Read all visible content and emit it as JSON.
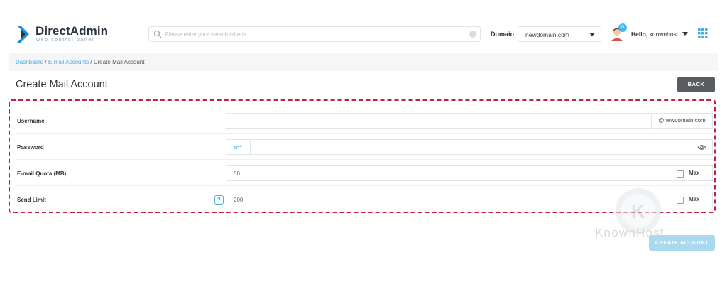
{
  "brand": {
    "name": "DirectAdmin",
    "tagline": "web control panel",
    "accent": "#1d8ed6"
  },
  "header": {
    "search_placeholder": "Please enter your search criteria",
    "domain_label": "Domain",
    "domain_value": "newdomain.com",
    "notification_count": "0",
    "hello_prefix": "Hello,",
    "username": "knownhost"
  },
  "breadcrumb": {
    "items": [
      "Dashboard",
      "E-mail Accounts",
      "Create Mail Account"
    ],
    "separator": " / "
  },
  "page": {
    "title": "Create Mail Account",
    "back_label": "BACK"
  },
  "form": {
    "username": {
      "label": "Username",
      "value": "",
      "suffix": "@newdomain.com"
    },
    "password": {
      "label": "Password",
      "value": ""
    },
    "quota": {
      "label": "E-mail Quota (MB)",
      "value": "50",
      "max_label": "Max",
      "max_checked": false
    },
    "send_limit": {
      "label": "Send Limit",
      "value": "200",
      "help": "?",
      "max_label": "Max",
      "max_checked": false
    },
    "submit_label": "CREATE ACCOUNT"
  },
  "watermark": {
    "text": "KnownHost"
  },
  "colors": {
    "highlight_border": "#c4203c",
    "link": "#4aaee0",
    "back_button": "#5a5d60",
    "create_button": "#a9d8ef"
  },
  "icons": [
    "directadmin-logo-icon",
    "search-icon",
    "clear-icon",
    "chevron-down-icon",
    "user-avatar-icon",
    "apps-grid-icon",
    "key-generate-icon",
    "eye-icon",
    "help-icon"
  ]
}
